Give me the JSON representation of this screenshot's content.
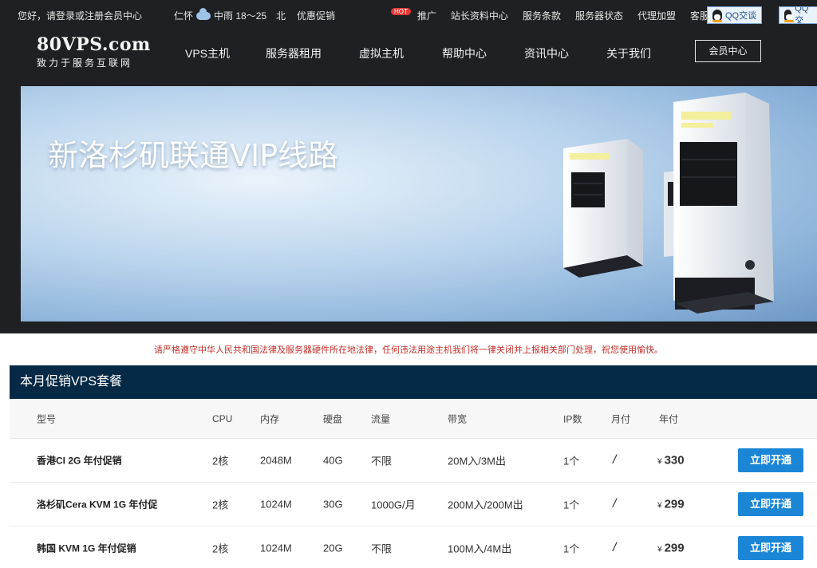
{
  "topbar": {
    "greeting": "您好，请登录或注册会员中心",
    "weather_city": "仁怀",
    "weather_text": "中雨 18～25",
    "weather_more": "北",
    "links": [
      {
        "label": "优惠促销",
        "badge": "HOT"
      },
      {
        "label": "推广"
      },
      {
        "label": "站长资料中心"
      },
      {
        "label": "服务条款"
      },
      {
        "label": "服务器状态"
      },
      {
        "label": "代理加盟"
      },
      {
        "label": "客服QQ"
      }
    ],
    "qq_button_1": "QQ交谈",
    "qq_button_2": "QQ交"
  },
  "brand": {
    "name": "80VPS.com",
    "slogan": "致力于服务互联网"
  },
  "menu": [
    "VPS主机",
    "服务器租用",
    "虚拟主机",
    "帮助中心",
    "资讯中心",
    "关于我们"
  ],
  "member_button": "会员中心",
  "banner": {
    "title": "新洛杉矶联通VIP线路"
  },
  "notice": "请严格遵守中华人民共和国法律及服务器硬件所在地法律，任何违法用途主机我们将一律关闭并上报相关部门处理，祝您使用愉快。",
  "packages": {
    "title": "本月促销VPS套餐",
    "columns": [
      "型号",
      "CPU",
      "内存",
      "硬盘",
      "流量",
      "带宽",
      "IP数",
      "月付",
      "年付"
    ],
    "rows": [
      {
        "model": "香港CI 2G 年付促销",
        "cpu": "2核",
        "ram": "2048M",
        "disk": "40G",
        "traffic": "不限",
        "bandwidth": "20M入/3M出",
        "ip": "1个",
        "monthly": "/",
        "currency": "¥",
        "yearly": "330",
        "action": "立即开通"
      },
      {
        "model": "洛杉矶Cera KVM 1G 年付促",
        "cpu": "2核",
        "ram": "1024M",
        "disk": "30G",
        "traffic": "1000G/月",
        "bandwidth": "200M入/200M出",
        "ip": "1个",
        "monthly": "/",
        "currency": "¥",
        "yearly": "299",
        "action": "立即开通"
      },
      {
        "model": "韩国 KVM 1G 年付促销",
        "cpu": "2核",
        "ram": "1024M",
        "disk": "20G",
        "traffic": "不限",
        "bandwidth": "100M入/4M出",
        "ip": "1个",
        "monthly": "/",
        "currency": "¥",
        "yearly": "299",
        "action": "立即开通"
      }
    ]
  }
}
